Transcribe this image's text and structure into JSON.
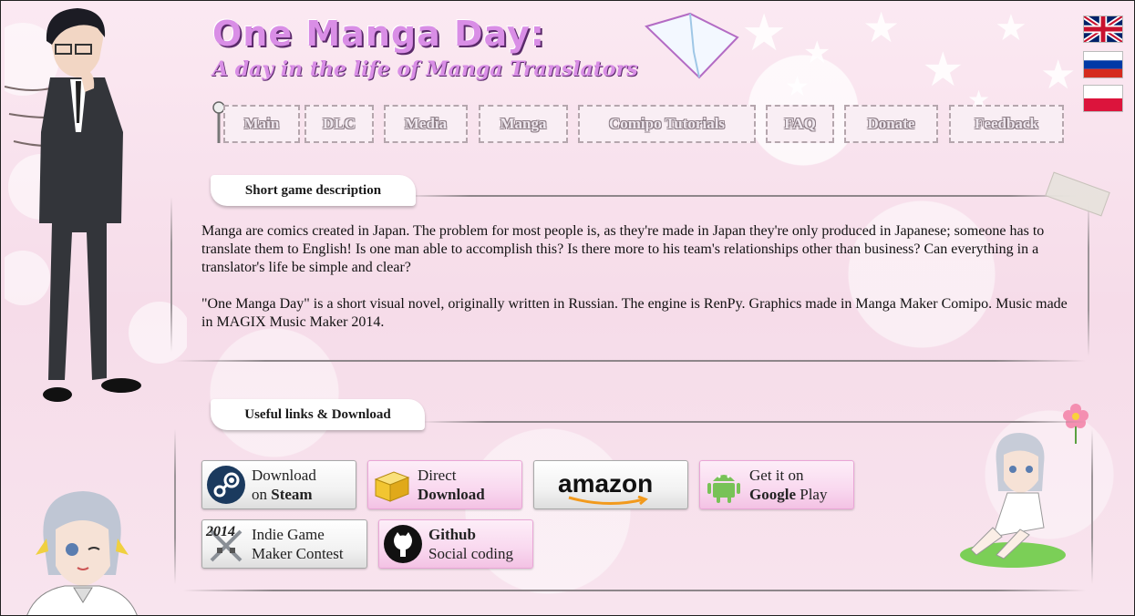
{
  "header": {
    "title": "One Manga Day:",
    "subtitle": "A day in the life of Manga Translators"
  },
  "flags": [
    {
      "name": "english",
      "colors": [
        "#012169",
        "#ffffff",
        "#c8102e"
      ]
    },
    {
      "name": "russian",
      "colors": [
        "#ffffff",
        "#0039a6",
        "#d52b1e"
      ]
    },
    {
      "name": "polish",
      "colors": [
        "#ffffff",
        "#dc143c"
      ]
    }
  ],
  "nav": {
    "items": [
      {
        "label": "Main"
      },
      {
        "label": "DLC"
      },
      {
        "label": "Media"
      },
      {
        "label": "Manga"
      },
      {
        "label": "Comipo Tutorials"
      },
      {
        "label": "FAQ"
      },
      {
        "label": "Donate"
      },
      {
        "label": "Feedback"
      }
    ]
  },
  "description": {
    "heading": "Short game description",
    "p1": "Manga are comics created in Japan. The problem for most people is, as they're made in Japan they're only produced in Japanese; someone has to translate them to English! Is one man able to accomplish this? Is there more to his team's relationships other than business? Can everything in a translator's life be simple and clear?",
    "p2": "\"One Manga Day\" is a short visual novel, originally written in Russian. The engine is RenPy. Graphics made in Manga Maker Comipo. Music made in MAGIX Music Maker 2014."
  },
  "links": {
    "heading": "Useful links & Download",
    "steam": {
      "line1": "Download",
      "line2a": "on ",
      "line2b": "Steam"
    },
    "direct": {
      "line1": "Direct",
      "line2": "Download"
    },
    "amazon": {
      "label": "amazon"
    },
    "google": {
      "line1": "Get it on",
      "line2a": "Google",
      "line2b": " Play"
    },
    "indie": {
      "line1": "Indie Game",
      "line2": "Maker Contest",
      "badge": "2014"
    },
    "github": {
      "line1": "Github",
      "line2": "Social coding"
    }
  },
  "colors": {
    "background": "#f7e3ee",
    "title": "#d98ee6",
    "pink_button": "#f9d8ef"
  }
}
